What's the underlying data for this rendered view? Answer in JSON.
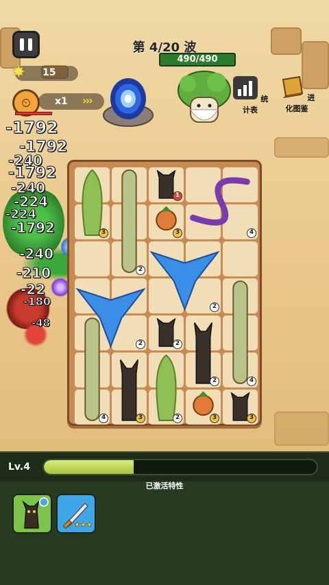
{
  "hud": {
    "wave_label": "第 4/20 波",
    "boss_hp": "490/490",
    "sun_count": "15",
    "speed": "x1",
    "speed_arrows": "›››",
    "stats_label": "统计表",
    "evolution_label": "进化图鉴"
  },
  "damage_numbers": [
    "-1792",
    "-1792",
    "-240",
    "-1792",
    "-240",
    "-224",
    "-224",
    "-1792",
    "-240",
    "-210",
    "-22",
    "-180",
    "-48"
  ],
  "board_units": [
    {
      "name": "willow-tree",
      "level": "3"
    },
    {
      "name": "sandworm",
      "level": "2"
    },
    {
      "name": "black-cat",
      "level": "1"
    },
    {
      "name": "potted-sprout",
      "level": "3"
    },
    {
      "name": "purple-serpent",
      "level": "4"
    },
    {
      "name": "blue-phoenix",
      "level": "2"
    },
    {
      "name": "blue-phoenix",
      "level": "2"
    },
    {
      "name": "black-cat",
      "level": "2"
    },
    {
      "name": "sandworm",
      "level": "4"
    },
    {
      "name": "black-cat",
      "level": "2"
    },
    {
      "name": "sandworm",
      "level": "4"
    },
    {
      "name": "black-cat",
      "level": "3"
    },
    {
      "name": "willow-tree",
      "level": "2"
    },
    {
      "name": "potted-sprout",
      "level": "3"
    },
    {
      "name": "black-cat",
      "level": "3"
    }
  ],
  "footer": {
    "level": "Lv.4",
    "xp_progress": 0.33,
    "trait_label": "已激活特性",
    "skill2_stars": "★★★"
  },
  "colors": {
    "board": "#c78a52",
    "cell": "#f1ddb6",
    "xp": "#b7d14a",
    "boss_hp": "#2a7d2a"
  }
}
